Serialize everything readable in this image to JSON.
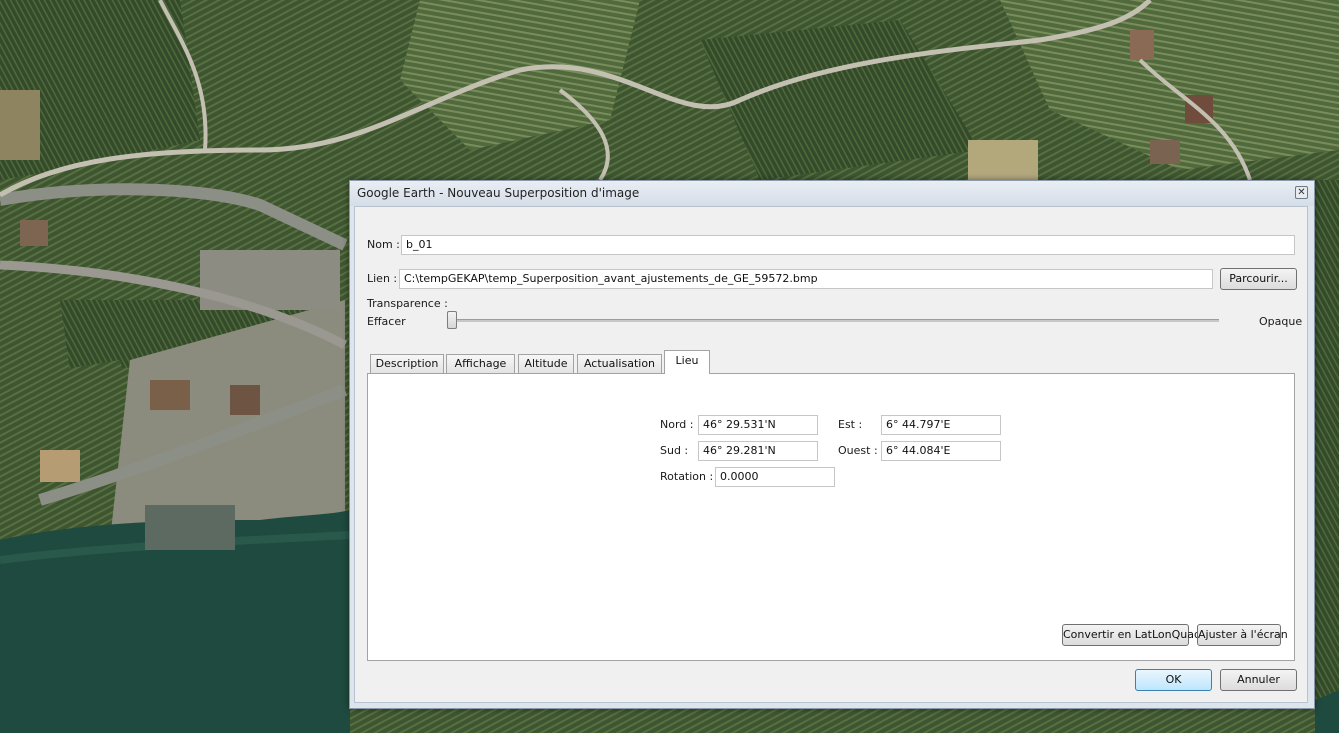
{
  "window": {
    "title": "Google Earth - Nouveau Superposition d'image",
    "close_icon": "close-icon"
  },
  "form": {
    "name_label": "Nom :",
    "name_value": "b_01",
    "link_label": "Lien :",
    "link_value": "C:\\tempGEKAP\\temp_Superposition_avant_ajustements_de_GE_59572.bmp",
    "browse_label": "Parcourir...",
    "transparency_label": "Transparence :",
    "slider_min_label": "Effacer",
    "slider_max_label": "Opaque",
    "transparency_level": 0.0
  },
  "tabs": [
    {
      "label": "Description",
      "active": false
    },
    {
      "label": "Affichage",
      "active": false
    },
    {
      "label": "Altitude",
      "active": false
    },
    {
      "label": "Actualisation",
      "active": false
    },
    {
      "label": "Lieu",
      "active": true
    }
  ],
  "location": {
    "north_label": "Nord :",
    "north_value": "46° 29.531'N",
    "east_label": "Est :",
    "east_value": "6° 44.797'E",
    "south_label": "Sud :",
    "south_value": "46° 29.281'N",
    "west_label": "Ouest :",
    "west_value": "6° 44.084'E",
    "rotation_label": "Rotation :",
    "rotation_value": "0.0000",
    "convert_label": "Convertir en LatLonQuad",
    "fit_label": "Ajuster à l'écran"
  },
  "footer": {
    "ok_label": "OK",
    "cancel_label": "Annuler"
  },
  "colors": {
    "map_vineyard": "#3f5532",
    "map_lake": "#1f4a3f",
    "dialog_bg": "#f0f0f0",
    "default_button": "#bee6fd"
  }
}
